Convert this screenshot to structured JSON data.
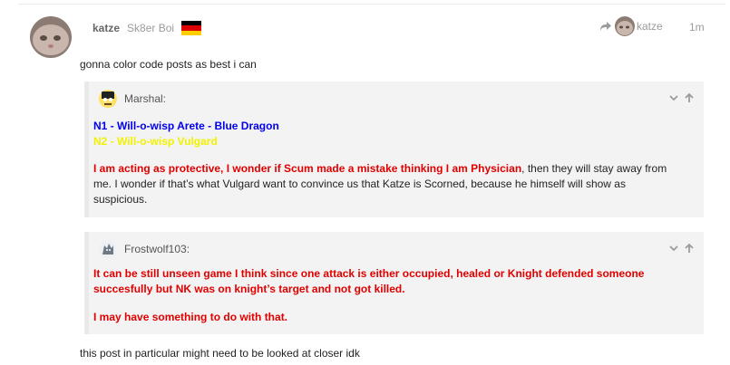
{
  "post": {
    "username": "katze",
    "user_title": "Sk8er Boi",
    "reply_to_username": "katze",
    "date": "1m",
    "intro_text": "gonna color code posts as best i can",
    "outro_text": "this post in particular might need to be looked at closer idk"
  },
  "quotes": [
    {
      "author": "Marshal:",
      "line1": "N1 - Will-o-wisp Arete - Blue Dragon",
      "line2": "N2 - Will-o-wisp Vulgard",
      "para_red": "I am acting as protective, I wonder if Scum made a mistake thinking I am Physician",
      "para_rest_1": ", then they will stay away from",
      "para_rest_2": "me. I wonder if that’s what Vulgard want to convince us that Katze is Scorned, because he himself will show as",
      "para_rest_3": "suspicious."
    },
    {
      "author": "Frostwolf103:",
      "p1_line1": "It can be still unseen game I think since one attack is either occupied, healed or Knight defended someone",
      "p1_line2": "succesfully but NK was on knight’s target and not got killed.",
      "p2": "I may have something to do with that."
    }
  ],
  "colors": {
    "blue_text": "#0000ee",
    "yellow_text": "#f2f200",
    "red_text": "#e00000",
    "quote_bg": "#f3f3f3",
    "quote_border": "#e9e9e9",
    "meta_gray": "#9b9b9b"
  },
  "icons": {
    "flag": "germany-flag-icon",
    "reply": "reply-arrow-icon",
    "expand": "chevron-down-icon",
    "jump": "arrow-up-icon"
  }
}
